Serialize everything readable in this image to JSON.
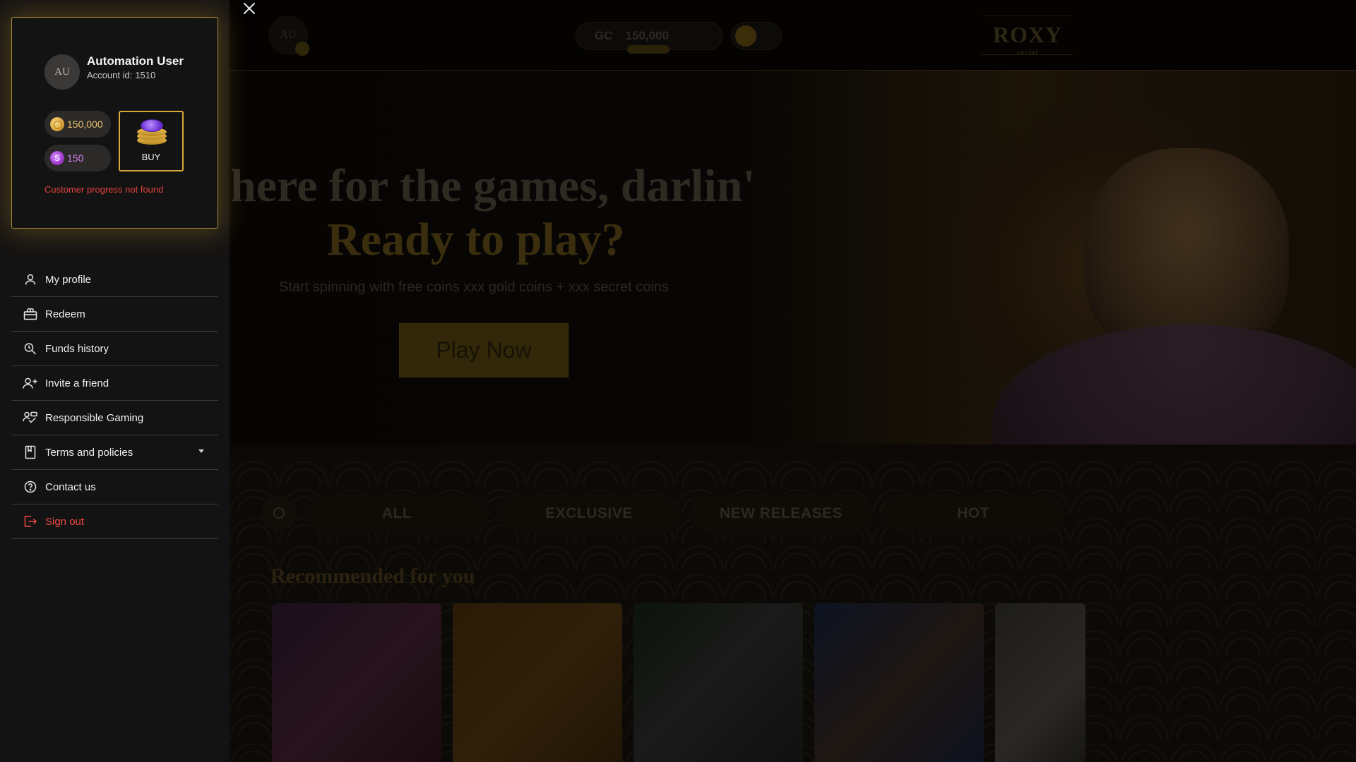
{
  "background_page": {
    "header": {
      "avatar_initials": "AU",
      "balance_currency": "GC",
      "balance_value": "150,000",
      "logo_text": "ROXY",
      "logo_subtext": "social"
    },
    "hero": {
      "title": "here for the games, darlin'",
      "subtitle": "Ready to play?",
      "description": "Start spinning with free coins xxx gold coins + xxx secret coins",
      "cta_label": "Play Now"
    },
    "tabs": [
      {
        "label": "ALL"
      },
      {
        "label": "EXCLUSIVE"
      },
      {
        "label": "NEW RELEASES"
      },
      {
        "label": "HOT"
      }
    ],
    "recommended_title": "Recommended for you"
  },
  "drawer": {
    "close_icon": "close-icon",
    "user": {
      "initials": "AU",
      "name": "Automation User",
      "account_label": "Account id:",
      "account_id": "1510"
    },
    "balances": {
      "gold_coins": "150,000",
      "secret_coins": "150"
    },
    "buy_label": "BUY",
    "progress_message": "Customer progress not found",
    "menu": [
      {
        "label": "My profile",
        "icon": "user-icon"
      },
      {
        "label": "Redeem",
        "icon": "gift-icon"
      },
      {
        "label": "Funds history",
        "icon": "search-history-icon"
      },
      {
        "label": "Invite a friend",
        "icon": "add-user-icon"
      },
      {
        "label": "Responsible Gaming",
        "icon": "responsible-gaming-icon"
      },
      {
        "label": "Terms and policies",
        "icon": "document-icon"
      },
      {
        "label": "Contact us",
        "icon": "help-icon"
      },
      {
        "label": "Sign out",
        "icon": "sign-out-icon"
      }
    ]
  },
  "colors": {
    "accent_gold": "#d9a83a",
    "error_red": "#e0433f",
    "signout_red": "#f04a45",
    "drawer_bg": "#141313"
  }
}
